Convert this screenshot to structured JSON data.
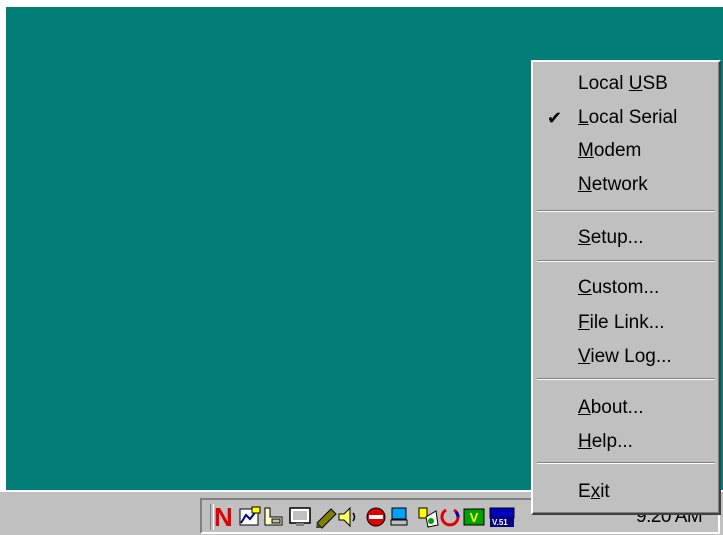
{
  "menu": {
    "items": [
      {
        "pre": "Local ",
        "key": "U",
        "post": "SB",
        "checked": false
      },
      {
        "pre": "",
        "key": "L",
        "post": "ocal Serial",
        "checked": true
      },
      {
        "pre": "",
        "key": "M",
        "post": "odem",
        "checked": false
      },
      {
        "pre": "",
        "key": "N",
        "post": "etwork",
        "checked": false
      },
      {
        "pre": "",
        "key": "S",
        "post": "etup...",
        "checked": false
      },
      {
        "pre": "",
        "key": "C",
        "post": "ustom...",
        "checked": false
      },
      {
        "pre": "",
        "key": "F",
        "post": "ile Link...",
        "checked": false
      },
      {
        "pre": "",
        "key": "V",
        "post": "iew Log...",
        "checked": false
      },
      {
        "pre": "",
        "key": "A",
        "post": "bout...",
        "checked": false
      },
      {
        "pre": "",
        "key": "H",
        "post": "elp...",
        "checked": false
      },
      {
        "pre": "E",
        "key": "x",
        "post": "it",
        "checked": false
      }
    ],
    "check_glyph": "✔"
  },
  "taskbar": {
    "clock": "9:20 AM",
    "tray_n_label": "N",
    "tray_badge_text": "V.51"
  },
  "icons": {
    "tray": [
      "netscape-icon",
      "chart-icon",
      "phone-icon",
      "monitor-icon",
      "pen-icon",
      "speaker-icon",
      "no-entry-icon",
      "computer-icon",
      "paint-icon",
      "power-icon",
      "v-icon",
      "modem-icon"
    ]
  },
  "colors": {
    "desktop": "#017e77",
    "menu_bg": "#c0c0c0",
    "netscape_red": "#e00000"
  }
}
